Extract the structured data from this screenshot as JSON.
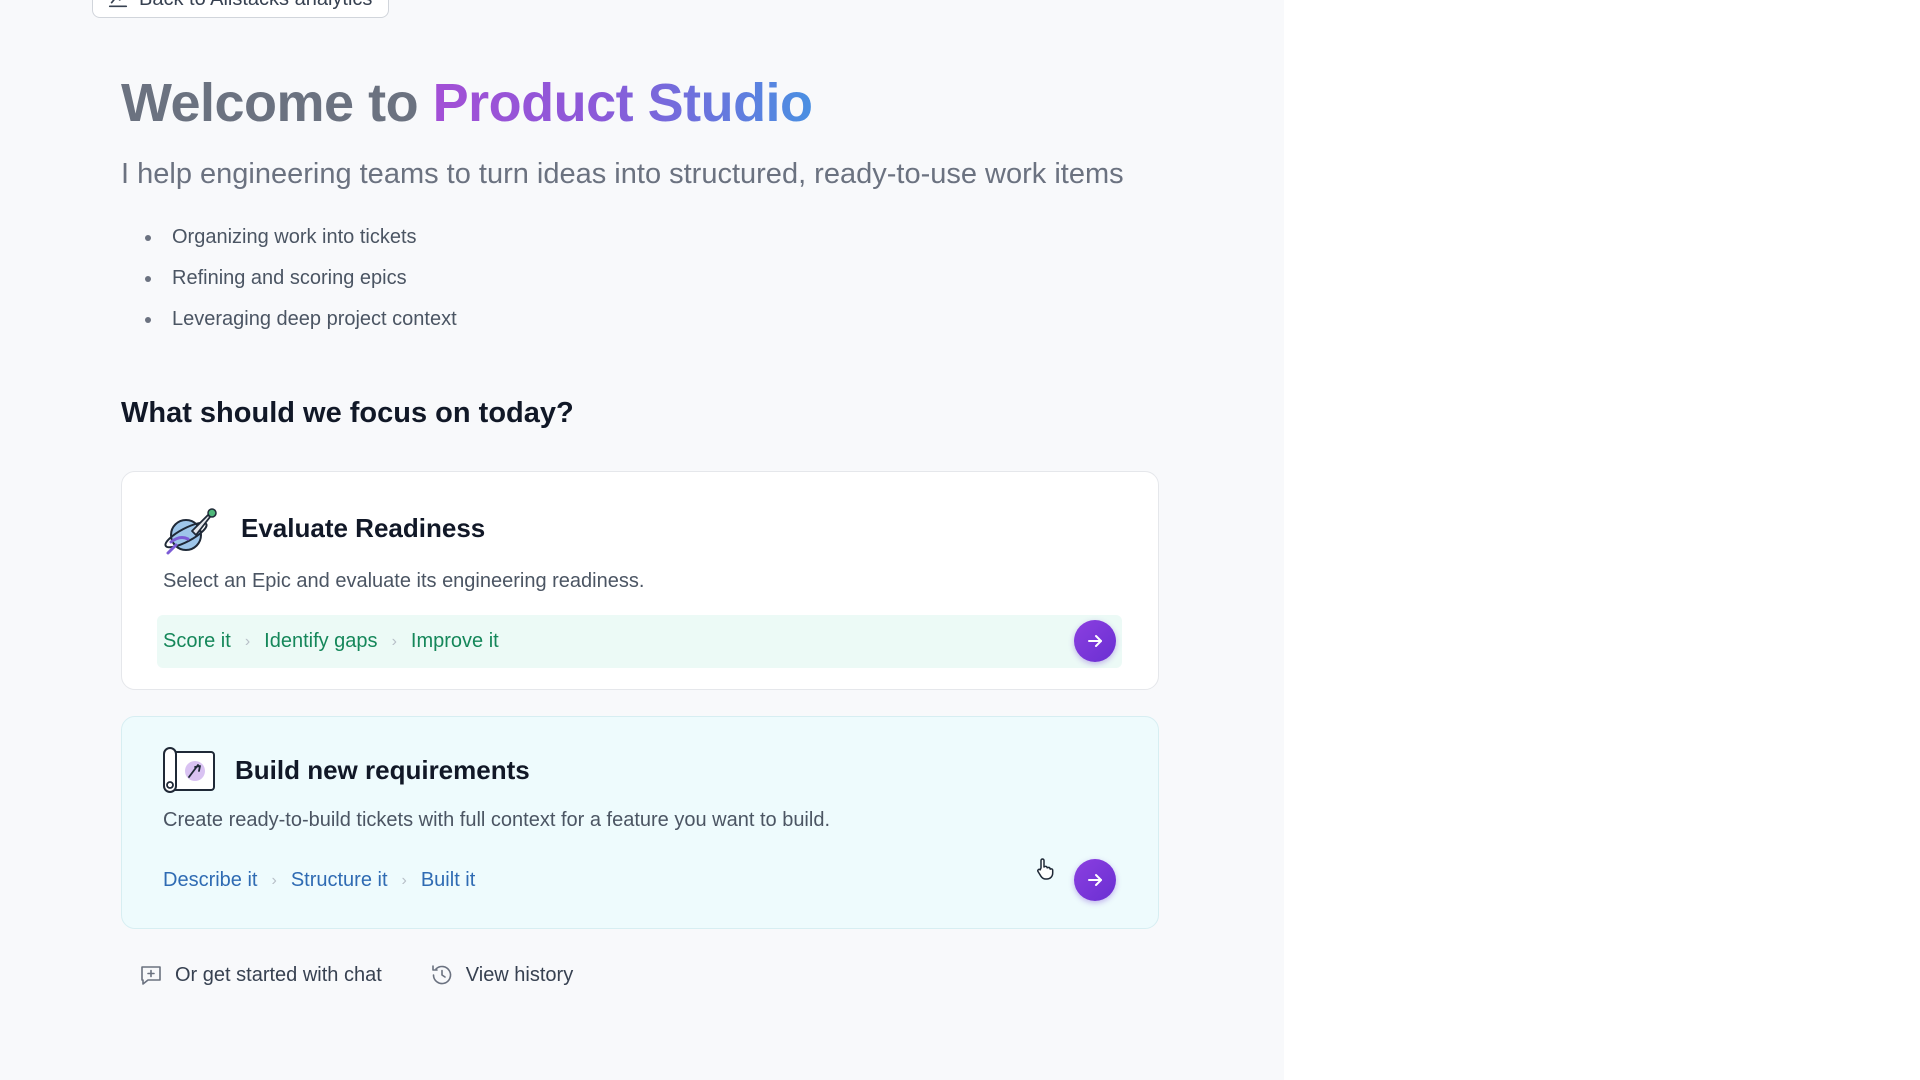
{
  "nav": {
    "back_label": "Back to Allstacks analytics"
  },
  "hero": {
    "title_prefix": "Welcome to ",
    "title_brand": "Product Studio",
    "tagline": "I help engineering teams to turn ideas into structured, ready-to-use work items",
    "capabilities": [
      "Organizing work into tickets",
      "Refining and scoring epics",
      "Leveraging deep project context"
    ]
  },
  "focus": {
    "heading": "What should we focus on today?",
    "cards": [
      {
        "title": "Evaluate Readiness",
        "description": "Select an Epic and evaluate its engineering readiness.",
        "steps": [
          "Score it",
          "Identify gaps",
          "Improve it"
        ]
      },
      {
        "title": "Build new requirements",
        "description": "Create ready-to-build tickets with full context for a feature you want to build.",
        "steps": [
          "Describe it",
          "Structure it",
          "Built it"
        ]
      }
    ]
  },
  "footer": {
    "chat_label": "Or get started with chat",
    "history_label": "View history"
  },
  "colors": {
    "brand_gradient_start": "#a34fd6",
    "brand_gradient_end": "#4a90e2",
    "action_button": "#7a35da",
    "evaluate_step_text": "#15875a",
    "build_step_text": "#2f6bb3"
  },
  "icons": {
    "back": "analytics-icon",
    "evaluate": "rocket-planet-icon",
    "build": "blueprint-scroll-icon",
    "go": "arrow-right-icon",
    "chat": "chat-plus-icon",
    "history": "history-icon"
  }
}
